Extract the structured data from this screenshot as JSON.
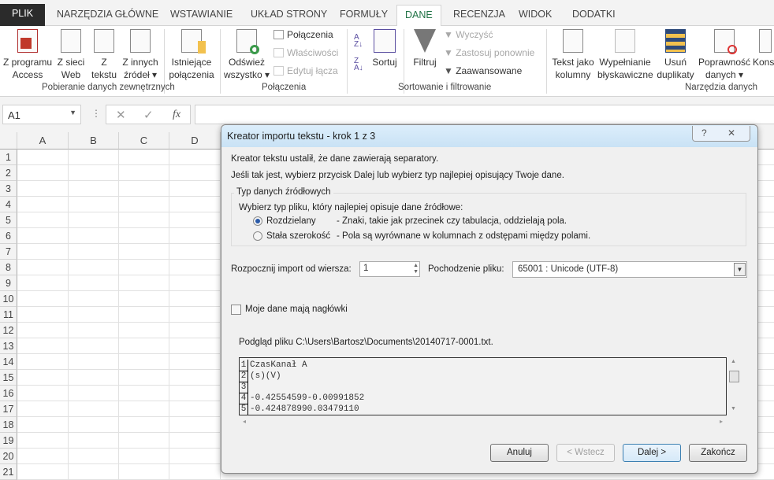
{
  "tabs": [
    "PLIK",
    "NARZĘDZIA GŁÓWNE",
    "WSTAWIANIE",
    "UKŁAD STRONY",
    "FORMUŁY",
    "DANE",
    "RECENZJA",
    "WIDOK",
    "DODATKI"
  ],
  "active_tab": "DANE",
  "ribbon": {
    "get_external": {
      "label": "Pobieranie danych zewnętrznych",
      "buttons": [
        [
          "Z programu",
          "Access"
        ],
        [
          "Z sieci",
          "Web"
        ],
        [
          "Z",
          "tekstu"
        ],
        [
          "Z innych",
          "źródeł"
        ],
        [
          "Istniejące",
          "połączenia"
        ]
      ]
    },
    "connections": {
      "label": "Połączenia",
      "refresh": [
        "Odśwież",
        "wszystko"
      ],
      "items": [
        "Połączenia",
        "Właściwości",
        "Edytuj łącza"
      ]
    },
    "sort_filter": {
      "label": "Sortowanie i filtrowanie",
      "sort": "Sortuj",
      "filter": "Filtruj",
      "items": [
        "Wyczyść",
        "Zastosuj ponownie",
        "Zaawansowane"
      ]
    },
    "data_tools": {
      "label": "Narzędzia danych",
      "buttons": [
        [
          "Tekst jako",
          "kolumny"
        ],
        [
          "Wypełnianie",
          "błyskawiczne"
        ],
        [
          "Usuń",
          "duplikaty"
        ],
        [
          "Poprawność",
          "danych"
        ],
        [
          "Kons",
          ""
        ]
      ]
    }
  },
  "formula_bar": {
    "name_box": "A1",
    "fx": "fx",
    "value": ""
  },
  "columns": [
    "A",
    "B",
    "C",
    "D"
  ],
  "rows": [
    "1",
    "2",
    "3",
    "4",
    "5",
    "6",
    "7",
    "8",
    "9",
    "10",
    "11",
    "12",
    "13",
    "14",
    "15",
    "16",
    "17",
    "18",
    "19",
    "20",
    "21"
  ],
  "dialog": {
    "title": "Kreator importu tekstu - krok 1 z 3",
    "help": "?",
    "close": "✕",
    "line1": "Kreator tekstu ustalił, że dane zawierają separatory.",
    "line2": "Jeśli tak jest, wybierz przycisk Dalej lub wybierz typ najlepiej opisujący Twoje dane.",
    "group_title": "Typ danych źródłowych",
    "group_prompt": "Wybierz typ pliku, który najlepiej opisuje dane źródłowe:",
    "options": [
      {
        "label": "Rozdzielany",
        "desc": "- Znaki, takie jak przecinek czy tabulacja, oddzielają pola.",
        "selected": true
      },
      {
        "label": "Stała szerokość",
        "desc": "- Pola są wyrównane w kolumnach z odstępami między polami.",
        "selected": false
      }
    ],
    "start_row_label": "Rozpocznij import od wiersza:",
    "start_row": "1",
    "origin_label": "Pochodzenie pliku:",
    "origin": "65001 : Unicode (UTF-8)",
    "headers_label": "Moje dane mają nagłówki",
    "headers_checked": false,
    "preview_label": "Podgląd pliku C:\\Users\\Bartosz\\Documents\\20140717-0001.txt.",
    "preview": [
      {
        "n": "1",
        "text": "CzasKanał A"
      },
      {
        "n": "2",
        "text": "(s)(V)"
      },
      {
        "n": "3",
        "text": ""
      },
      {
        "n": "4",
        "text": "-0.42554599-0.00991852"
      },
      {
        "n": "5",
        "text": "-0.424878990.03479110"
      }
    ],
    "buttons": {
      "cancel": "Anuluj",
      "back": "< Wstecz",
      "next": "Dalej >",
      "finish": "Zakończ"
    }
  }
}
